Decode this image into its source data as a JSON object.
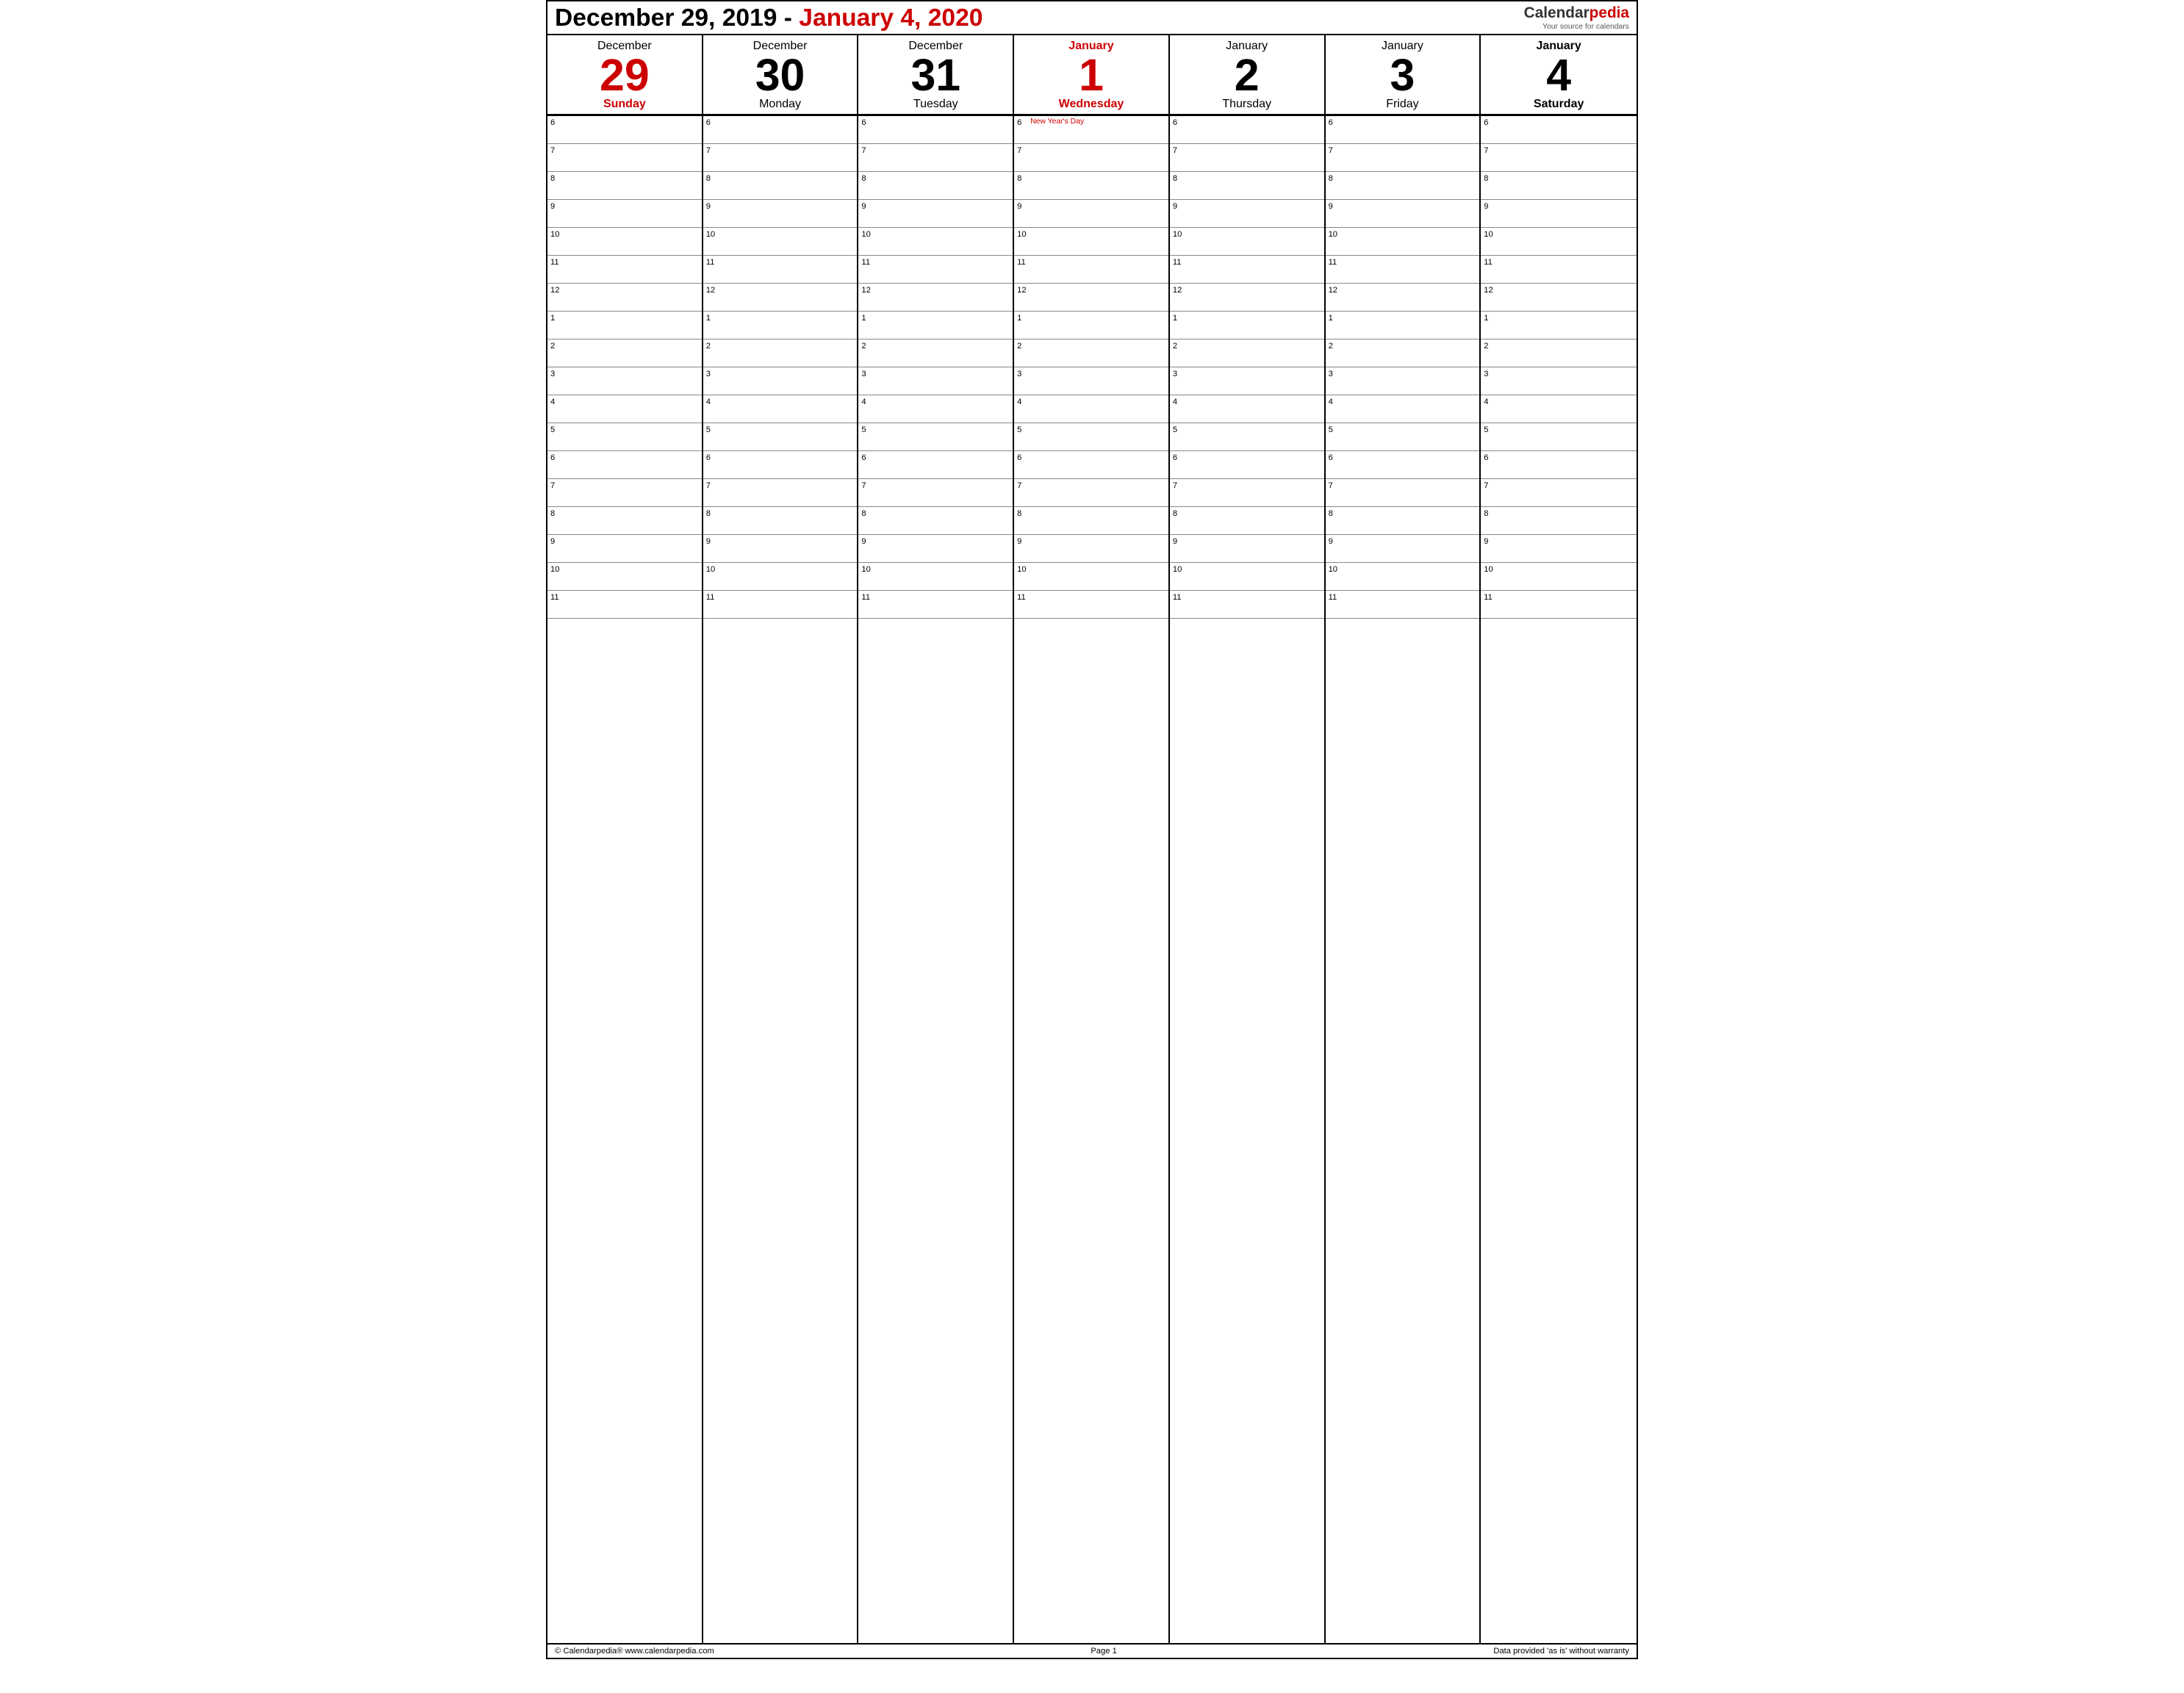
{
  "header": {
    "title_start": "December 29, 2019 - ",
    "title_end": "January 4, 2020"
  },
  "logo": {
    "name_start": "Calendar",
    "name_end": "pedia",
    "tagline": "Your source for calendars"
  },
  "days": [
    {
      "month": "December",
      "month_red": false,
      "month_bold": false,
      "number": "29",
      "number_red": true,
      "dayname": "Sunday",
      "dayname_red": true,
      "dayname_bold": true
    },
    {
      "month": "December",
      "month_red": false,
      "month_bold": false,
      "number": "30",
      "number_red": false,
      "dayname": "Monday",
      "dayname_red": false,
      "dayname_bold": false
    },
    {
      "month": "December",
      "month_red": false,
      "month_bold": false,
      "number": "31",
      "number_red": false,
      "dayname": "Tuesday",
      "dayname_red": false,
      "dayname_bold": false
    },
    {
      "month": "January",
      "month_red": true,
      "month_bold": true,
      "number": "1",
      "number_red": true,
      "dayname": "Wednesday",
      "dayname_red": true,
      "dayname_bold": true
    },
    {
      "month": "January",
      "month_red": false,
      "month_bold": false,
      "number": "2",
      "number_red": false,
      "dayname": "Thursday",
      "dayname_red": false,
      "dayname_bold": false
    },
    {
      "month": "January",
      "month_red": false,
      "month_bold": false,
      "number": "3",
      "number_red": false,
      "dayname": "Friday",
      "dayname_red": false,
      "dayname_bold": false
    },
    {
      "month": "January",
      "month_red": false,
      "month_bold": true,
      "number": "4",
      "number_red": false,
      "dayname": "Saturday",
      "dayname_red": false,
      "dayname_bold": true
    }
  ],
  "time_slots": [
    {
      "label": "6",
      "major": true
    },
    {
      "label": "7",
      "major": true
    },
    {
      "label": "8",
      "major": true
    },
    {
      "label": "9",
      "major": true
    },
    {
      "label": "10",
      "major": true
    },
    {
      "label": "11",
      "major": true
    },
    {
      "label": "12",
      "major": true
    },
    {
      "label": "1",
      "major": true
    },
    {
      "label": "2",
      "major": true
    },
    {
      "label": "3",
      "major": true
    },
    {
      "label": "4",
      "major": true
    },
    {
      "label": "5",
      "major": true
    },
    {
      "label": "6",
      "major": true
    },
    {
      "label": "7",
      "major": true
    },
    {
      "label": "8",
      "major": true
    },
    {
      "label": "9",
      "major": true
    },
    {
      "label": "10",
      "major": true
    },
    {
      "label": "11",
      "major": true
    }
  ],
  "events": {
    "jan1_slot0": "New Year's Day"
  },
  "footer": {
    "left": "© Calendarpedia®   www.calendarpedia.com",
    "center": "Page 1",
    "right": "Data provided 'as is' without warranty"
  }
}
